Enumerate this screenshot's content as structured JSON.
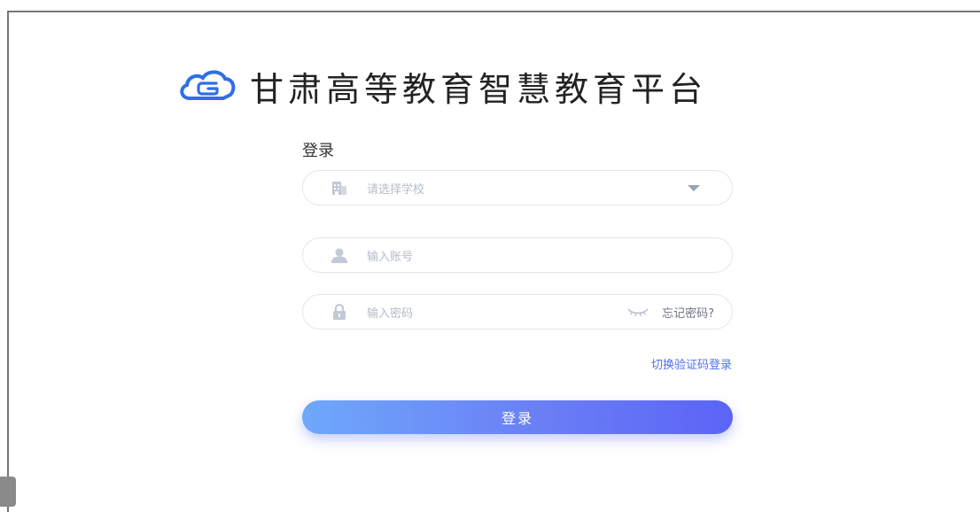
{
  "brand": {
    "title": "甘肃高等教育智慧教育平台",
    "logo_icon": "cloud-g-logo-icon",
    "accent_color": "#2f6fe8"
  },
  "login": {
    "heading": "登录",
    "school_select": {
      "placeholder": "请选择学校",
      "icon": "building-icon"
    },
    "account_input": {
      "placeholder": "输入账号",
      "icon": "user-icon"
    },
    "password_input": {
      "placeholder": "输入密码",
      "icon": "lock-icon",
      "toggle_icon": "eye-closed-icon"
    },
    "forgot_password": "忘记密码?",
    "switch_mode": "切换验证码登录",
    "submit": "登录"
  },
  "colors": {
    "link": "#4f6ff2",
    "button_gradient_start": "#6ea8fb",
    "button_gradient_end": "#5b64f6",
    "placeholder": "#b5bcc8"
  }
}
